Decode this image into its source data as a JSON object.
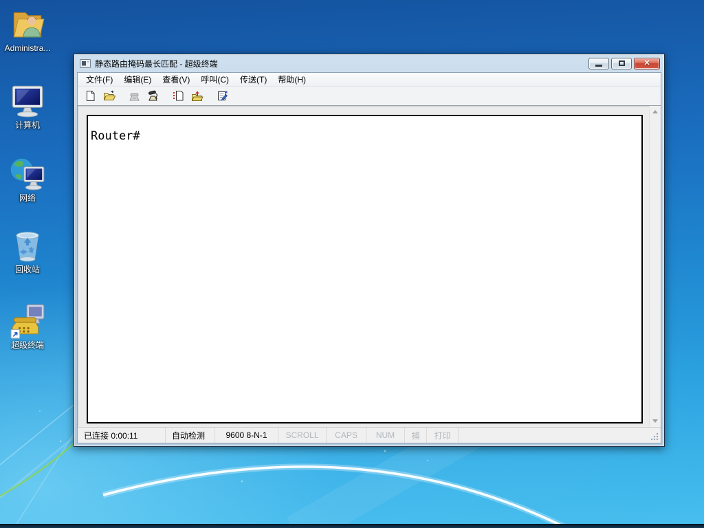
{
  "colors": {
    "desktop_top": "#14529e",
    "desktop_bottom": "#46bfee",
    "titlebar": "#bcd1e4",
    "close_button_red": "#c74434",
    "status_disabled_text": "#b3b8bc",
    "terminal_background": "#ffffff"
  },
  "desktop": {
    "icons": [
      {
        "name": "administrator-folder",
        "label": "Administra..."
      },
      {
        "name": "computer",
        "label": "计算机"
      },
      {
        "name": "network",
        "label": "网络"
      },
      {
        "name": "recycle-bin",
        "label": "回收站"
      },
      {
        "name": "hyperterminal-shortcut",
        "label": "超级终端"
      }
    ]
  },
  "window": {
    "title": "静态路由掩码最长匹配 - 超级终端",
    "controls": [
      "minimize",
      "maximize",
      "close"
    ],
    "close_glyph": "✕",
    "menu": [
      {
        "label": "文件(F)"
      },
      {
        "label": "编辑(E)"
      },
      {
        "label": "查看(V)"
      },
      {
        "label": "呼叫(C)"
      },
      {
        "label": "传送(T)"
      },
      {
        "label": "帮助(H)"
      }
    ],
    "toolbar": [
      {
        "icon": "new-connection-icon",
        "enabled": true
      },
      {
        "icon": "open-icon",
        "enabled": true
      },
      {
        "icon": "call-icon",
        "enabled": false
      },
      {
        "icon": "disconnect-icon",
        "enabled": true
      },
      {
        "icon": "send-file-icon",
        "enabled": true
      },
      {
        "icon": "receive-file-icon",
        "enabled": true
      },
      {
        "icon": "properties-icon",
        "enabled": true
      }
    ],
    "terminal": {
      "text": "Router#"
    },
    "statusbar": [
      {
        "label": "已连接 0:00:11",
        "disabled": false
      },
      {
        "label": "自动检测",
        "disabled": false
      },
      {
        "label": "9600 8-N-1",
        "disabled": false
      },
      {
        "label": "SCROLL",
        "disabled": true
      },
      {
        "label": "CAPS",
        "disabled": true
      },
      {
        "label": "NUM",
        "disabled": true
      },
      {
        "label": "捕",
        "disabled": true
      },
      {
        "label": "打印",
        "disabled": true
      }
    ]
  }
}
